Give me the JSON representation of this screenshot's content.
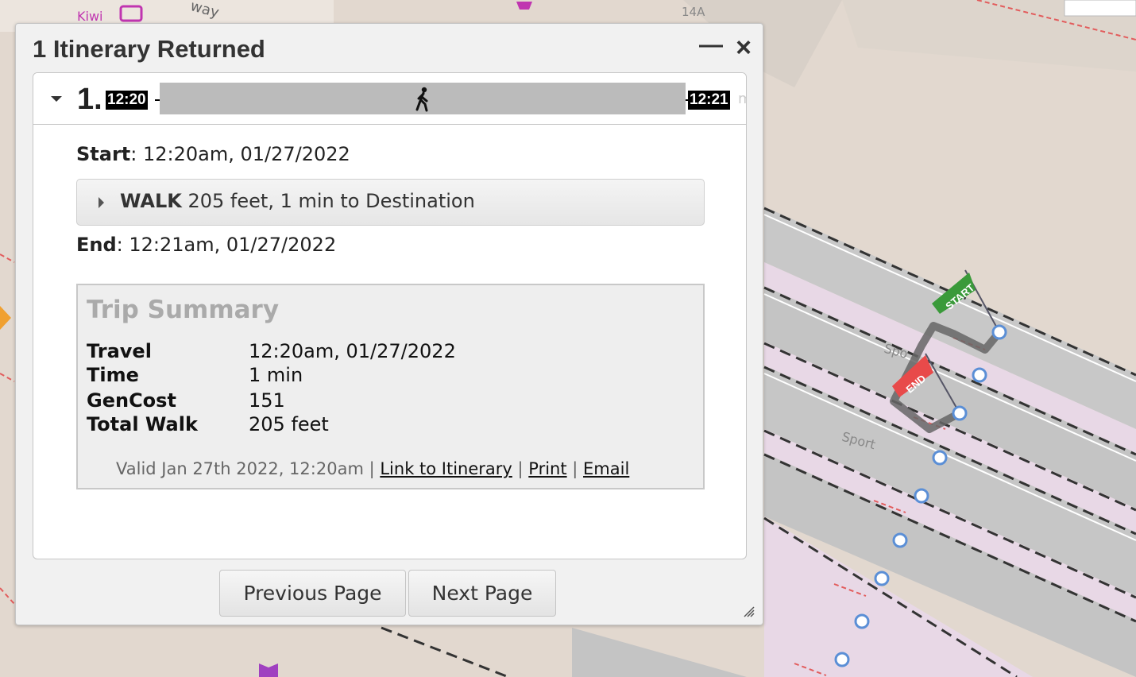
{
  "map": {
    "labels": [
      "Kiwi",
      "way",
      "14A",
      "Sport",
      "Sport",
      "Spo"
    ],
    "start_flag": "START",
    "end_flag": "END"
  },
  "dialog": {
    "title": "1 Itinerary Returned",
    "minimize_glyph": "—",
    "close_glyph": "×"
  },
  "itinerary": {
    "number": "1.",
    "start_time": "12:20",
    "end_time": "12:21",
    "mode_icon": "walk-icon",
    "faint_suffix": "m",
    "start_label": "Start",
    "start_value": ": 12:20am, 01/27/2022",
    "leg": {
      "mode": "WALK",
      "detail": " 205 feet, 1 min to Destination"
    },
    "end_label": "End",
    "end_value": ": 12:21am, 01/27/2022"
  },
  "summary": {
    "title": "Trip Summary",
    "rows": [
      {
        "label": "Travel",
        "value": "12:20am, 01/27/2022"
      },
      {
        "label": "Time",
        "value": "1 min"
      },
      {
        "label": "GenCost",
        "value": "151"
      },
      {
        "label": "Total Walk",
        "value": "205 feet"
      }
    ],
    "valid_text": "Valid Jan 27th 2022, 12:20am",
    "separator": " | ",
    "links": [
      "Link to Itinerary",
      "Print",
      "Email"
    ]
  },
  "pagination": {
    "previous": "Previous Page",
    "next": "Next Page"
  },
  "colors": {
    "start_flag": "#3a9a3a",
    "end_flag": "#e84a4a",
    "stop_marker": "#5b8fd6",
    "route": "#777777"
  }
}
